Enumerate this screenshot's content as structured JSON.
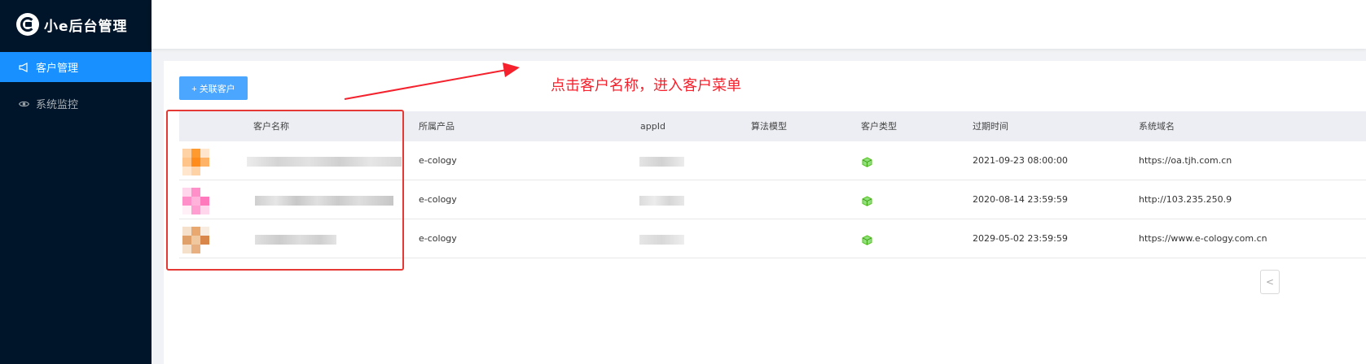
{
  "app": {
    "title": "小e后台管理"
  },
  "sidebar": {
    "items": [
      {
        "label": "客户管理",
        "icon": "megaphone-icon",
        "active": true
      },
      {
        "label": "系统监控",
        "icon": "eye-icon",
        "active": false
      }
    ]
  },
  "toolbar": {
    "add_label": "+ 关联客户"
  },
  "annotation": {
    "text": "点击客户名称，进入客户菜单"
  },
  "table": {
    "columns": [
      "客户名称",
      "所属产品",
      "appId",
      "算法模型",
      "客户类型",
      "过期时间",
      "系统域名"
    ],
    "rows": [
      {
        "name": "",
        "product": "e-cology",
        "appId": "",
        "model": "",
        "type_icon": "cube-icon",
        "expire": "2021-09-23 08:00:00",
        "domain": "https://oa.tjh.com.cn"
      },
      {
        "name": "",
        "product": "e-cology",
        "appId": "",
        "model": "",
        "type_icon": "cube-icon",
        "expire": "2020-08-14 23:59:59",
        "domain": "http://103.235.250.9"
      },
      {
        "name": "",
        "product": "e-cology",
        "appId": "",
        "model": "",
        "type_icon": "cube-icon",
        "expire": "2029-05-02 23:59:59",
        "domain": "https://www.e-cology.com.cn"
      }
    ]
  },
  "pagination": {
    "prev_symbol": "<"
  },
  "colors": {
    "sidebar_bg": "#001529",
    "active": "#1890ff",
    "button": "#4ba6ff",
    "annotation": "#f5222d",
    "type_icon": "#52c41a"
  }
}
